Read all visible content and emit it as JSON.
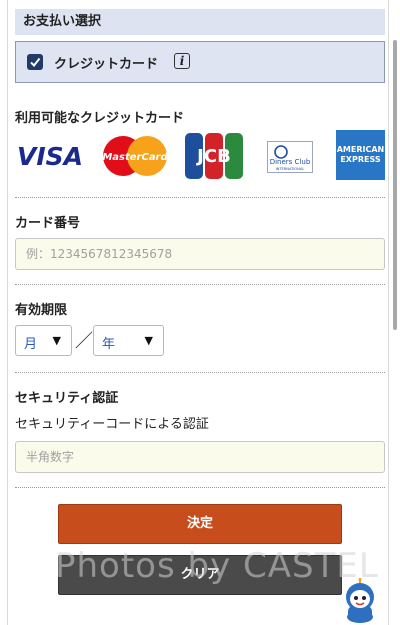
{
  "payment_section": {
    "title": "お支払い選択",
    "option_label": "クレジットカード",
    "info_glyph": "i"
  },
  "available_cards": {
    "title": "利用可能なクレジットカード",
    "logos": [
      {
        "name": "VISA",
        "text": "VISA"
      },
      {
        "name": "MasterCard",
        "text": "MasterCard"
      },
      {
        "name": "JCB",
        "text": "JCB"
      },
      {
        "name": "Diners Club",
        "text": "Diners Club",
        "subtext": "INTERNATIONAL"
      },
      {
        "name": "American Express",
        "text": "AMERICAN",
        "subtext": "EXPRESS"
      }
    ]
  },
  "card_number": {
    "label": "カード番号",
    "placeholder": "例：1234567812345678"
  },
  "expiry": {
    "label": "有効期限",
    "month_label": "月",
    "year_label": "年",
    "separator": "／"
  },
  "security": {
    "label": "セキュリティ認証",
    "description": "セキュリティーコードによる認証",
    "placeholder": "半角数字"
  },
  "buttons": {
    "submit": "決定",
    "clear": "クリア"
  },
  "watermark": "Photos by CASTEL",
  "colors": {
    "accent": "#c74e1c",
    "header_bg": "#dde3f1",
    "checkbox": "#1f3b66",
    "clear_button": "#4a4a4a",
    "input_bg": "#fbfbec"
  }
}
